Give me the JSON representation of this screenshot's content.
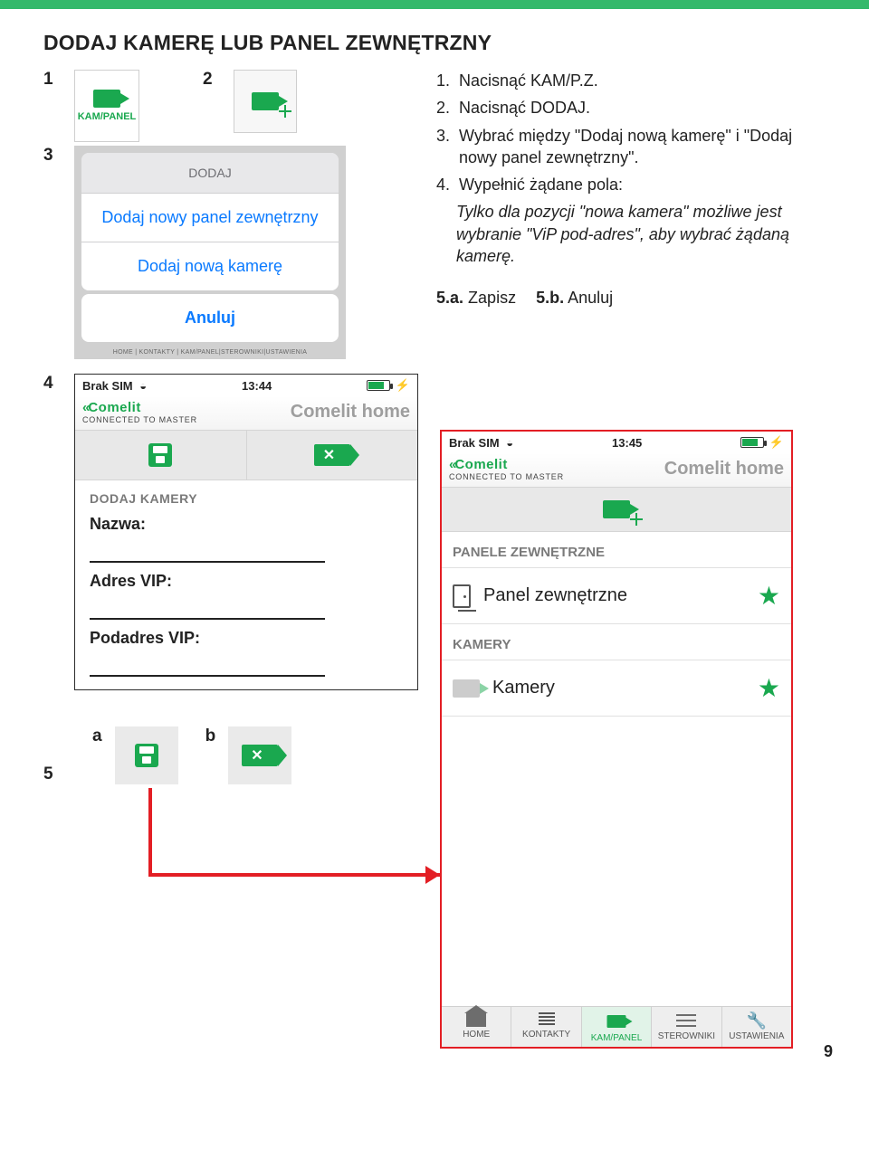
{
  "heading": "DODAJ KAMERĘ LUB PANEL ZEWNĘTRZNY",
  "page_number": "9",
  "step_numbers": {
    "s1": "1",
    "s2": "2",
    "s3": "3",
    "s4": "4",
    "s5": "5",
    "s5a": "a",
    "s5b": "b"
  },
  "tile1": {
    "label": "KAM/PANEL"
  },
  "instructions": {
    "i1_lead": "1.",
    "i1_text": "Nacisnąć KAM/P.Z.",
    "i2_lead": "2.",
    "i2_text": "Nacisnąć DODAJ.",
    "i3_lead": "3.",
    "i3_text": "Wybrać między \"Dodaj nową kamerę\" i \"Dodaj nowy panel zewnętrzny\".",
    "i4_lead": "4.",
    "i4_text": "Wypełnić żądane pola:",
    "i4_sub": "Tylko dla pozycji \"nowa kamera\" możliwe jest wybranie \"ViP pod-adres\", aby wybrać żądaną kamerę.",
    "i5a_lead": "5.a.",
    "i5a_text": "Zapisz",
    "i5b_lead": "5.b.",
    "i5b_text": "Anuluj"
  },
  "actionsheet": {
    "header": "DODAJ",
    "opt1": "Dodaj nowy panel zewnętrzny",
    "opt2": "Dodaj nową kamerę",
    "cancel": "Anuluj",
    "tinytabs": "HOME  | KONTAKTY | KAM/PANEL|STEROWNIKI|USTAWIENIA"
  },
  "phone1": {
    "carrier": "Brak SIM",
    "time": "13:44",
    "brand": "Comelit",
    "brand_sub": "CONNECTED TO MASTER",
    "title": "Comelit home",
    "section": "DODAJ KAMERY",
    "field1": "Nazwa:",
    "field2": "Adres VIP:",
    "field3": "Podadres VIP:"
  },
  "phone2": {
    "carrier": "Brak SIM",
    "time": "13:45",
    "brand": "Comelit",
    "brand_sub": "CONNECTED TO MASTER",
    "title": "Comelit home",
    "group1": "PANELE ZEWNĘTRZNE",
    "item1": "Panel zewnętrzne",
    "group2": "KAMERY",
    "item2": "Kamery",
    "tabs": {
      "home": "HOME",
      "k": "KONTAKTY",
      "kp": "KAM/PANEL",
      "st": "STEROWNIKI",
      "us": "USTAWIENIA"
    }
  }
}
